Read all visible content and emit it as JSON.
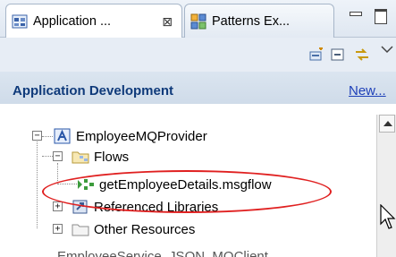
{
  "tabs": [
    {
      "label": "Application ...",
      "icon": "application-view-icon",
      "active": true,
      "close": "⊠"
    },
    {
      "label": "Patterns Ex...",
      "icon": "patterns-explorer-icon",
      "active": false
    }
  ],
  "window_controls": {
    "minimize": "minimize-icon",
    "maximize": "maximize-icon"
  },
  "toolbar": {
    "icons": [
      "new-application-icon",
      "collapse-all-icon",
      "link-with-editor-icon",
      "view-menu-icon"
    ]
  },
  "header": {
    "title": "Application Development",
    "link": "New..."
  },
  "tree": {
    "project": {
      "label": "EmployeeMQProvider",
      "icon": "application-project-icon",
      "expanded": true
    },
    "flows": {
      "label": "Flows",
      "icon": "flows-folder-icon",
      "expanded": true
    },
    "flow_file": {
      "label": "getEmployeeDetails.msgflow",
      "icon": "message-flow-icon"
    },
    "referenced": {
      "label": "Referenced Libraries",
      "icon": "referenced-libraries-icon",
      "expanded": false
    },
    "other": {
      "label": "Other Resources",
      "icon": "other-resources-folder-icon",
      "expanded": false
    },
    "next_project": {
      "label": "EmployeeService_JSON_MQClient"
    }
  },
  "annotation": {
    "color": "#e02020"
  }
}
